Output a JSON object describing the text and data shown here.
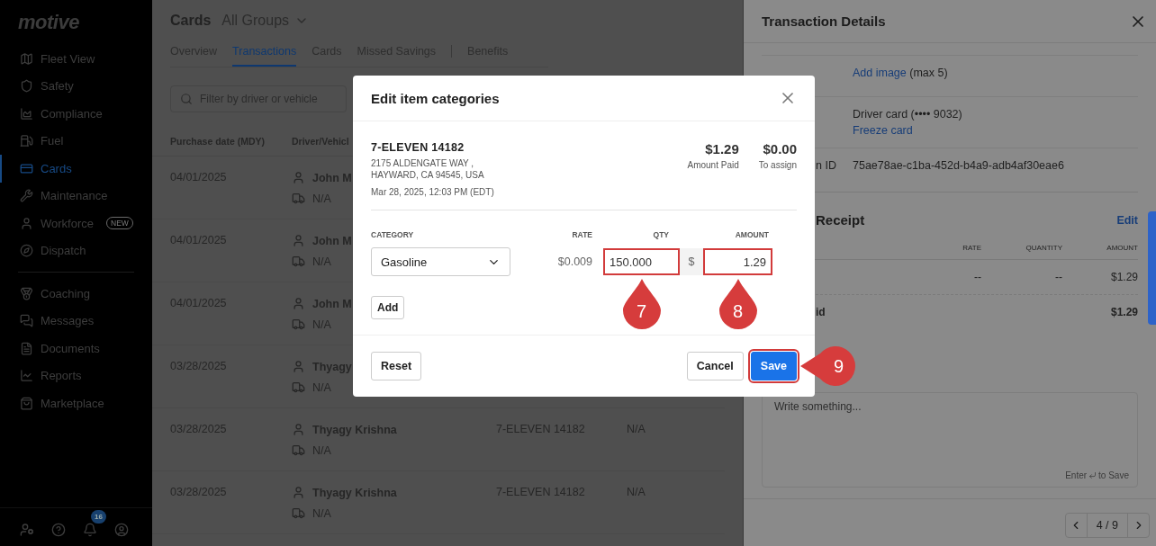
{
  "sidebar": {
    "logo": "motive",
    "items": [
      {
        "label": "Fleet View",
        "selected": false,
        "divider_after": false
      },
      {
        "label": "Safety",
        "selected": false,
        "divider_after": false
      },
      {
        "label": "Compliance",
        "selected": false,
        "divider_after": false
      },
      {
        "label": "Fuel",
        "selected": false,
        "divider_after": false
      },
      {
        "label": "Cards",
        "selected": true,
        "divider_after": false
      },
      {
        "label": "Maintenance",
        "selected": false,
        "divider_after": false
      },
      {
        "label": "Workforce",
        "selected": false,
        "divider_after": false,
        "badge": "NEW"
      },
      {
        "label": "Dispatch",
        "selected": false,
        "divider_after": true
      },
      {
        "label": "Coaching",
        "selected": false,
        "divider_after": false
      },
      {
        "label": "Messages",
        "selected": false,
        "divider_after": false
      },
      {
        "label": "Documents",
        "selected": false,
        "divider_after": false
      },
      {
        "label": "Reports",
        "selected": false,
        "divider_after": false
      },
      {
        "label": "Marketplace",
        "selected": false,
        "divider_after": false
      }
    ],
    "footer": {
      "notifications": "16"
    }
  },
  "page": {
    "title": "Cards",
    "group": "All Groups",
    "tabs": [
      {
        "label": "Overview",
        "selected": false,
        "divider_before": false
      },
      {
        "label": "Transactions",
        "selected": true,
        "divider_before": false
      },
      {
        "label": "Cards",
        "selected": false,
        "divider_before": false
      },
      {
        "label": "Missed Savings",
        "selected": false,
        "divider_before": false
      },
      {
        "label": "Benefits",
        "selected": false,
        "divider_before": true
      }
    ],
    "search": {
      "placeholder": "Filter by driver or vehicle"
    },
    "table": {
      "columns": [
        "Purchase date (MDY)",
        "Driver/Vehicl"
      ],
      "rows": [
        {
          "date": "04/01/2025",
          "driver": "John M",
          "vehicle": "N/A"
        },
        {
          "date": "04/01/2025",
          "driver": "John M",
          "vehicle": "N/A"
        },
        {
          "date": "04/01/2025",
          "driver": "John M",
          "vehicle": "N/A"
        },
        {
          "date": "03/28/2025",
          "driver": "Thyagy",
          "vehicle": "N/A"
        },
        {
          "date": "03/28/2025",
          "driver": "Thyagy Krishna",
          "vehicle": "N/A",
          "merchant": "7-ELEVEN 14182",
          "column_4": "N/A"
        },
        {
          "date": "03/28/2025",
          "driver": "Thyagy Krishna",
          "vehicle": "N/A",
          "merchant": "7-ELEVEN 14182",
          "column_4": "N/A"
        }
      ]
    }
  },
  "drawer": {
    "title": "Transaction Details",
    "receipt_link": "Add image",
    "receipt_note": "(max 5)",
    "card": "Driver card (•••• 9032)",
    "card_link": "Freeze card",
    "id_label": "n ID",
    "id_value": "75ae78ae-c1ba-452d-b4a9-adb4af30eae6",
    "section_title": "Receipt",
    "edit": "Edit",
    "columns": [
      "RATE",
      "QUANTITY",
      "AMOUNT"
    ],
    "item": {
      "rate": "--",
      "quantity": "--",
      "amount": "$1.29"
    },
    "total": {
      "label": "id",
      "amount": "$1.29"
    },
    "notes": {
      "placeholder": "Write something...",
      "hint_before": "Enter",
      "hint_after": "to Save"
    },
    "pager": "4 / 9"
  },
  "modal": {
    "title": "Edit item categories",
    "merchant": "7-ELEVEN 14182",
    "address_1": "2175 ALDENGATE WAY ,",
    "address_2": "HAYWARD, CA 94545, USA",
    "time": "Mar 28, 2025, 12:03 PM (EDT)",
    "paid": {
      "value": "$1.29",
      "label": "Amount Paid"
    },
    "assign": {
      "value": "$0.00",
      "label": "To assign"
    },
    "columns": [
      "CATEGORY",
      "RATE",
      "QTY",
      "AMOUNT"
    ],
    "line": {
      "category": "Gasoline",
      "rate": "$0.009",
      "qty": {
        "value": "150.000",
        "highlighted": true,
        "callout": "7"
      },
      "currency": "$",
      "amount": {
        "value": "1.29",
        "highlighted": true,
        "callout": "8"
      }
    },
    "add": "Add",
    "buttons": {
      "reset": "Reset",
      "cancel": "Cancel",
      "save": {
        "label": "Save",
        "highlighted": true,
        "callout": "9"
      }
    }
  }
}
